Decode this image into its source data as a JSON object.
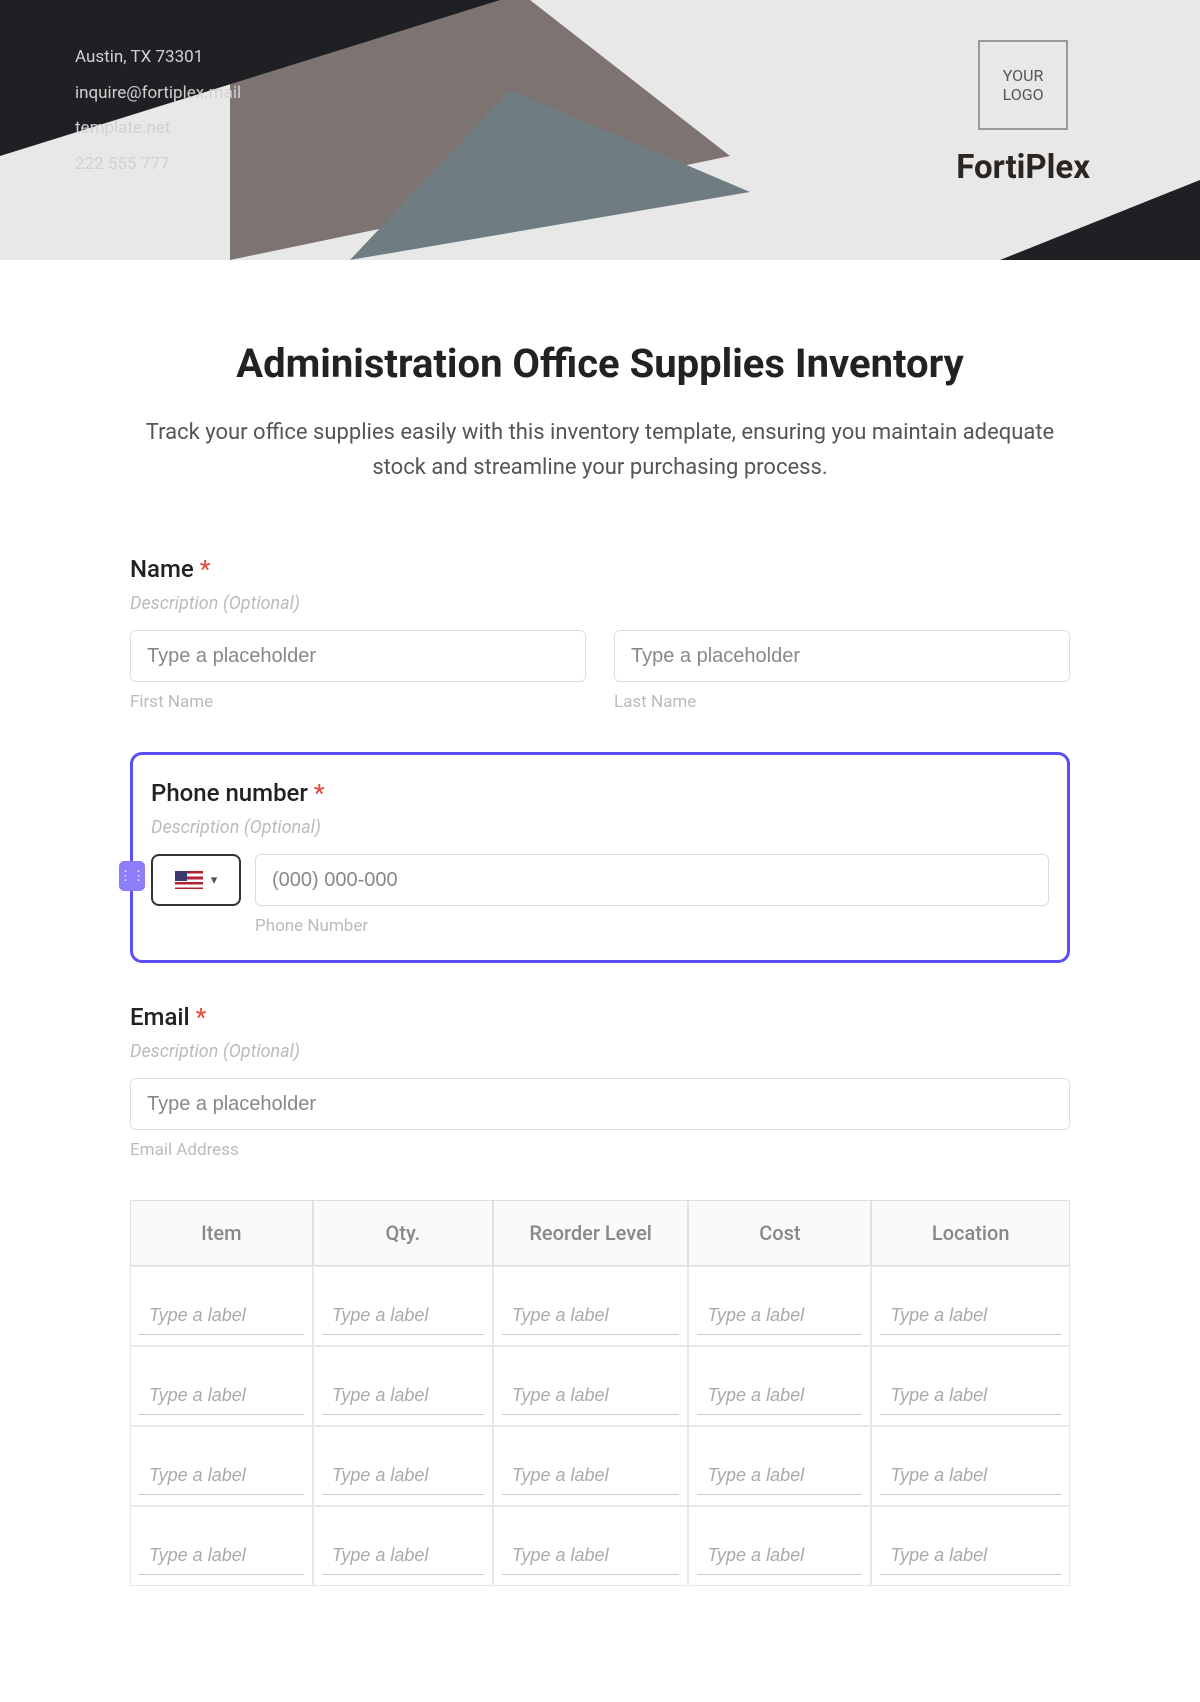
{
  "header": {
    "contact": {
      "address": "Austin, TX 73301",
      "email": "inquire@fortiplex.mail",
      "website": "template.net",
      "phone": "222 555 777"
    },
    "logo_text": "YOUR\nLOGO",
    "brand": "FortiPlex"
  },
  "page": {
    "title": "Administration Office Supplies Inventory",
    "subtitle": "Track your office supplies easily with this inventory template, ensuring you maintain adequate stock and streamline your purchasing process."
  },
  "fields": {
    "name": {
      "label": "Name",
      "desc": "Description (Optional)",
      "first_placeholder": "Type a placeholder",
      "last_placeholder": "Type a placeholder",
      "first_sub": "First Name",
      "last_sub": "Last Name"
    },
    "phone": {
      "label": "Phone number",
      "desc": "Description (Optional)",
      "placeholder": "(000) 000-000",
      "sub": "Phone Number"
    },
    "email": {
      "label": "Email",
      "desc": "Description (Optional)",
      "placeholder": "Type a placeholder",
      "sub": "Email Address"
    }
  },
  "table": {
    "headers": [
      "Item",
      "Qty.",
      "Reorder Level",
      "Cost",
      "Location"
    ],
    "cell_placeholder": "Type a label",
    "rows": 4
  }
}
